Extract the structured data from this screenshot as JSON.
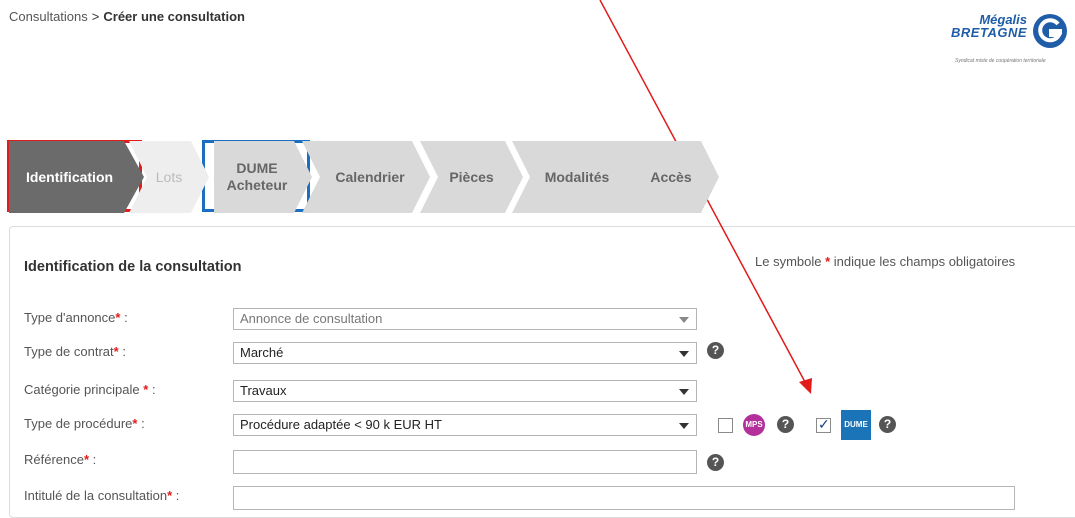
{
  "breadcrumb": {
    "parent": "Consultations",
    "separator": ">",
    "current": "Créer une consultation"
  },
  "logo": {
    "line1": "Mégalis",
    "line2": "BRETAGNE",
    "tagline": "Syndicat mixte de coopération territoriale"
  },
  "steps": [
    {
      "label": "Identification",
      "state": "active"
    },
    {
      "label": "Lots",
      "state": "disabled"
    },
    {
      "label": "DUME Acheteur",
      "state": "default"
    },
    {
      "label": "Calendrier",
      "state": "default"
    },
    {
      "label": "Pièces",
      "state": "default"
    },
    {
      "label": "Modalités",
      "state": "default"
    },
    {
      "label": "Accès",
      "state": "default"
    }
  ],
  "panel": {
    "title": "Identification de la consultation",
    "required_note_prefix": "Le symbole",
    "required_star": "*",
    "required_note_suffix": "indique les champs obligatoires"
  },
  "form": {
    "type_annonce": {
      "label": "Type d'annonce",
      "value": "Annonce de consultation"
    },
    "type_contrat": {
      "label": "Type de contrat",
      "value": "Marché"
    },
    "categorie": {
      "label": "Catégorie principale",
      "value": "Travaux"
    },
    "type_procedure": {
      "label": "Type de procédure",
      "value": "Procédure adaptée < 90 k EUR HT"
    },
    "reference": {
      "label": "Référence",
      "value": ""
    },
    "intitule": {
      "label": "Intitulé de la consultation",
      "value": ""
    },
    "colon": ":",
    "star": "*"
  },
  "options": {
    "mps_checked": false,
    "mps_badge": "MPS",
    "dume_checked": true,
    "dume_badge": "DUME"
  },
  "help_glyph": "?",
  "colors": {
    "active_step": "#6b6b6b",
    "step": "#d9d9d9",
    "red_highlight": "#e21b1b",
    "blue_highlight": "#1b6fbf",
    "mps": "#b3309a",
    "dume": "#1b74b8"
  }
}
